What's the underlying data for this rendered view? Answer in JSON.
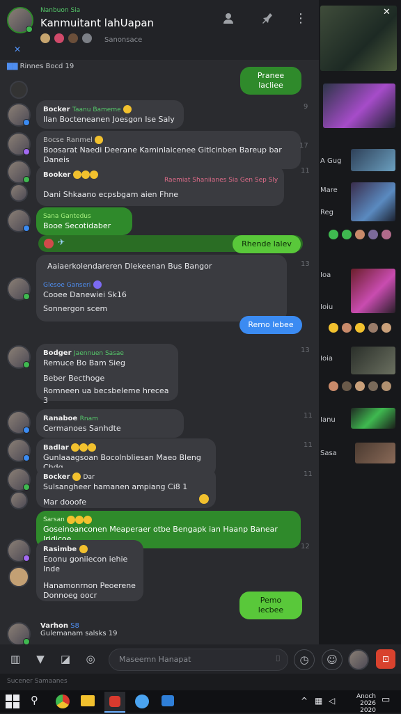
{
  "header": {
    "subtitle": "Nanbuon Sia",
    "title": "Kanmuitant lahUapan",
    "members_text": "Sanonsace",
    "icons": [
      "add-user-icon",
      "pin-icon",
      "more-vert-icon"
    ]
  },
  "messages": [
    {
      "id": "m0",
      "text": "Rinnes Bocd  19",
      "kind": "system"
    },
    {
      "id": "m1",
      "text": "Pranee lacliee",
      "kind": "out-green"
    },
    {
      "id": "m2",
      "name": "Bocker",
      "tag": "Taanu Bameme",
      "text": "Ilan Bocteneanen Joesgon Ise Saly",
      "time": "9"
    },
    {
      "id": "m3",
      "name": "Bocse Ranmel",
      "text": "Boosarat Naedi Deerane Kaminlaicenee Gitlcinben Bareup bar Daneis",
      "time": "17"
    },
    {
      "id": "m4",
      "name": "Booker",
      "text": "Dani Shkaano ecpsbgam aien Fhne",
      "extra": "Raemiat Shaniianes  Sia Gen Sep Sly",
      "time": "11"
    },
    {
      "id": "m5",
      "name": "Sana Gantedus",
      "text": "Booe Secotidaber",
      "kind": "in-green"
    },
    {
      "id": "m6",
      "text": "Rhende lalev",
      "kind": "out-lgreen"
    },
    {
      "id": "m7",
      "name": "Glesoe Ganseri",
      "text": "Aaiaerkolendareren Dlekeenan Bus Bangor",
      "sub": "Cooee Danewiei Sk16",
      "sub2": "Sonnergon scem",
      "time": "13"
    },
    {
      "id": "m8",
      "text": "Remo lebee",
      "kind": "out-blue"
    },
    {
      "id": "m9",
      "name": "Bodger",
      "tag": "Jaennuen Sasae",
      "text": "Remuce Bo Bam Sieg",
      "sub": "Beber  Becthoge",
      "sub2": "Romneen ua becsbeleme  hrecea  3",
      "time": "13"
    },
    {
      "id": "m10",
      "name": "Ranaboe",
      "tag": "Rnam",
      "text": "Cermanoes Sanhdte",
      "time": "11"
    },
    {
      "id": "m11",
      "name": "Badlar",
      "text": "Gunlaaagsoan Bocolnbliesan Maeo Bleng Chdg",
      "time": "11"
    },
    {
      "id": "m12",
      "name": "Bocker",
      "tag": "Dar",
      "text": "Sulsangheer hamanen ampiang Ci8 1",
      "sub": "Mar dooofe",
      "time": "11"
    },
    {
      "id": "m13",
      "name": "Sarsan",
      "text": "Goseinoanconen Meaperaer otbe Bengapk ian Haanp Banear Iridicoe",
      "kind": "in-green"
    },
    {
      "id": "m14",
      "name": "Rasimbe",
      "text": "Eoonu goniiecon iehie Inde",
      "sub": "Hanamonrnon Peoerene",
      "sub2": "Donnoeg oocr",
      "time": "12"
    },
    {
      "id": "m15",
      "text": "Pemo lecbee",
      "kind": "out-lgreen"
    },
    {
      "id": "m16",
      "name": "Varhon",
      "tag": "S8",
      "text": "Gulemanam salsks 19"
    }
  ],
  "sidebar": {
    "items": [
      {
        "label": "A Gug"
      },
      {
        "label": "Mare"
      },
      {
        "label": "Reg"
      },
      {
        "label": "Ioa"
      },
      {
        "label": "Ioiu"
      },
      {
        "label": "Ioia"
      },
      {
        "label": "Ianu"
      },
      {
        "label": "Sasa"
      }
    ]
  },
  "composer": {
    "placeholder": "Maseemn Hanapat"
  },
  "statusbar": {
    "left": "Sucener  Samaanes"
  },
  "taskbar": {
    "time": "Anoch 2026",
    "date": "2020"
  },
  "colors": {
    "green": "#2f8a2b",
    "light_green": "#59c83a",
    "blue": "#3b8bf2",
    "online": "#3fb950",
    "background": "#2a2b2f"
  }
}
